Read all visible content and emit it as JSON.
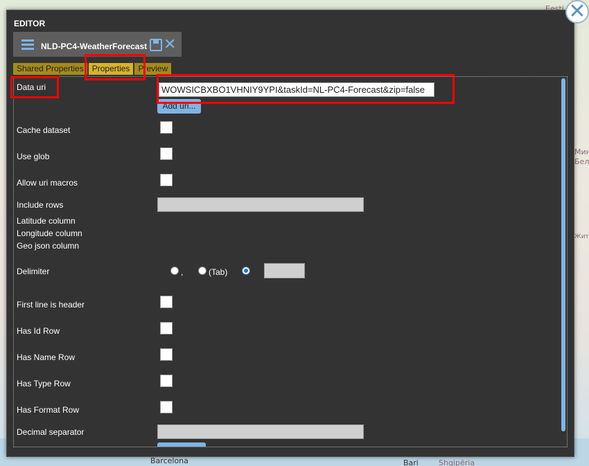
{
  "map": {
    "labels": [
      "Eesti",
      "Мин",
      "Бел",
      "Жит",
      "Barcelona",
      "Bari",
      "Shqipëria"
    ]
  },
  "editor": {
    "title": "EDITOR",
    "dataset_name": "NLD-PC4-WeatherForecast",
    "tabs": [
      {
        "label": "Shared Properties",
        "active": false
      },
      {
        "label": "Properties",
        "active": true
      },
      {
        "label": "Preview",
        "active": false
      }
    ],
    "fields": {
      "data_uri": {
        "label": "Data uri",
        "value": "WOWSICBXBO1VHNIY9YPI&taskId=NL-PC4-Forecast&zip=false"
      },
      "add_uri_label": "Add uri...",
      "cache_dataset": {
        "label": "Cache dataset",
        "checked": false
      },
      "use_glob": {
        "label": "Use glob",
        "checked": false
      },
      "allow_uri_macros": {
        "label": "Allow uri macros",
        "checked": false
      },
      "include_rows": {
        "label": "Include rows",
        "value": ""
      },
      "latitude_column": {
        "label": "Latitude column"
      },
      "longitude_column": {
        "label": "Longitude column"
      },
      "geo_json_column": {
        "label": "Geo json column"
      },
      "delimiter": {
        "label": "Delimiter",
        "options": [
          {
            "label": ",",
            "checked": false
          },
          {
            "label": "(Tab)",
            "checked": false
          },
          {
            "label": "",
            "checked": true
          }
        ],
        "custom_value": ""
      },
      "first_line_is_header": {
        "label": "First line is header",
        "checked": false
      },
      "has_id_row": {
        "label": "Has Id Row",
        "checked": false
      },
      "has_name_row": {
        "label": "Has Name Row",
        "checked": false
      },
      "has_type_row": {
        "label": "Has Type Row",
        "checked": false
      },
      "has_format_row": {
        "label": "Has Format Row",
        "checked": false
      },
      "decimal_separator": {
        "label": "Decimal separator",
        "value": ""
      }
    }
  },
  "colors": {
    "dialog_bg": "#333333",
    "accent": "#7fb4e3",
    "tab_active": "#d9b22a",
    "tab_inactive": "#a58b1c",
    "highlight": "#ff0000"
  }
}
